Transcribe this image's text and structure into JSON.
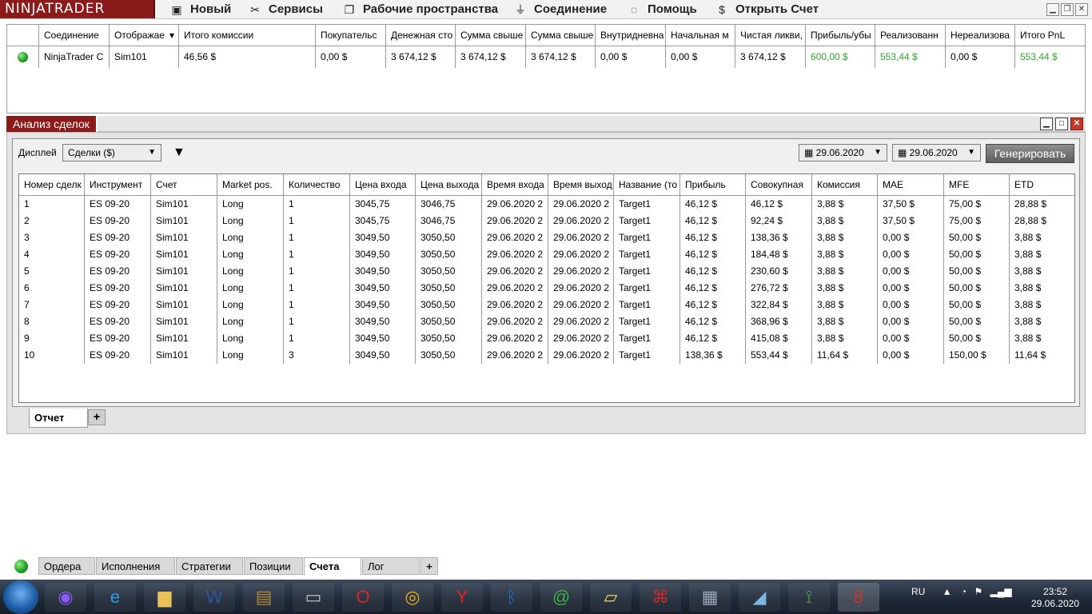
{
  "app": {
    "logo": "NINJATRADER"
  },
  "menu": [
    {
      "label": "Новый",
      "icon": "new-icon",
      "glyph": "▣"
    },
    {
      "label": "Сервисы",
      "icon": "tools-icon",
      "glyph": "✂"
    },
    {
      "label": "Рабочие пространства",
      "icon": "workspaces-icon",
      "glyph": "❐"
    },
    {
      "label": "Соединение",
      "icon": "plug-icon",
      "glyph": "⏚"
    },
    {
      "label": "Помощь",
      "icon": "help-icon",
      "glyph": "◌"
    },
    {
      "label": "Открыть Счет",
      "icon": "dollar-icon",
      "glyph": "$"
    }
  ],
  "accounts": {
    "headers": [
      "",
      "Соединение",
      "Отображае",
      "Итого комиссии",
      "Покупательс",
      "Денежная сто",
      "Сумма свыше",
      "Сумма свыше",
      "Внутридневна",
      "Начальная м",
      "Чистая ликви,",
      "Прибыль/убы",
      "Реализованн",
      "Нереализова",
      "Итого PnL"
    ],
    "sort_glyph": "▾",
    "row": [
      "",
      "NinjaTrader C",
      "Sim101",
      "46,56 $",
      "0,00 $",
      "3 674,12 $",
      "3 674,12 $",
      "3 674,12 $",
      "0,00 $",
      "0,00 $",
      "3 674,12 $",
      "600,00 $",
      "553,44 $",
      "0,00 $",
      "553,44 $"
    ]
  },
  "trade_analysis": {
    "title": "Анализ сделок",
    "display_label": "Дисплей",
    "display_value": "Сделки ($)",
    "date_from": "29.06.2020",
    "date_to": "29.06.2020",
    "generate_label": "Генерировать",
    "headers": [
      "Номер сделк",
      "Инструмент",
      "Счет",
      "Market pos.",
      "Количество",
      "Цена входа",
      "Цена выхода",
      "Время входа",
      "Время выход",
      "Название (то",
      "Прибыль",
      "Совокупная",
      "Комиссия",
      "MAE",
      "MFE",
      "ETD"
    ],
    "rows": [
      [
        "1",
        "ES 09-20",
        "Sim101",
        "Long",
        "1",
        "3045,75",
        "3046,75",
        "29.06.2020 2",
        "29.06.2020 2",
        "Target1",
        "46,12 $",
        "46,12 $",
        "3,88 $",
        "37,50 $",
        "75,00 $",
        "28,88 $"
      ],
      [
        "2",
        "ES 09-20",
        "Sim101",
        "Long",
        "1",
        "3045,75",
        "3046,75",
        "29.06.2020 2",
        "29.06.2020 2",
        "Target1",
        "46,12 $",
        "92,24 $",
        "3,88 $",
        "37,50 $",
        "75,00 $",
        "28,88 $"
      ],
      [
        "3",
        "ES 09-20",
        "Sim101",
        "Long",
        "1",
        "3049,50",
        "3050,50",
        "29.06.2020 2",
        "29.06.2020 2",
        "Target1",
        "46,12 $",
        "138,36 $",
        "3,88 $",
        "0,00 $",
        "50,00 $",
        "3,88 $"
      ],
      [
        "4",
        "ES 09-20",
        "Sim101",
        "Long",
        "1",
        "3049,50",
        "3050,50",
        "29.06.2020 2",
        "29.06.2020 2",
        "Target1",
        "46,12 $",
        "184,48 $",
        "3,88 $",
        "0,00 $",
        "50,00 $",
        "3,88 $"
      ],
      [
        "5",
        "ES 09-20",
        "Sim101",
        "Long",
        "1",
        "3049,50",
        "3050,50",
        "29.06.2020 2",
        "29.06.2020 2",
        "Target1",
        "46,12 $",
        "230,60 $",
        "3,88 $",
        "0,00 $",
        "50,00 $",
        "3,88 $"
      ],
      [
        "6",
        "ES 09-20",
        "Sim101",
        "Long",
        "1",
        "3049,50",
        "3050,50",
        "29.06.2020 2",
        "29.06.2020 2",
        "Target1",
        "46,12 $",
        "276,72 $",
        "3,88 $",
        "0,00 $",
        "50,00 $",
        "3,88 $"
      ],
      [
        "7",
        "ES 09-20",
        "Sim101",
        "Long",
        "1",
        "3049,50",
        "3050,50",
        "29.06.2020 2",
        "29.06.2020 2",
        "Target1",
        "46,12 $",
        "322,84 $",
        "3,88 $",
        "0,00 $",
        "50,00 $",
        "3,88 $"
      ],
      [
        "8",
        "ES 09-20",
        "Sim101",
        "Long",
        "1",
        "3049,50",
        "3050,50",
        "29.06.2020 2",
        "29.06.2020 2",
        "Target1",
        "46,12 $",
        "368,96 $",
        "3,88 $",
        "0,00 $",
        "50,00 $",
        "3,88 $"
      ],
      [
        "9",
        "ES 09-20",
        "Sim101",
        "Long",
        "1",
        "3049,50",
        "3050,50",
        "29.06.2020 2",
        "29.06.2020 2",
        "Target1",
        "46,12 $",
        "415,08 $",
        "3,88 $",
        "0,00 $",
        "50,00 $",
        "3,88 $"
      ],
      [
        "10",
        "ES 09-20",
        "Sim101",
        "Long",
        "3",
        "3049,50",
        "3050,50",
        "29.06.2020 2",
        "29.06.2020 2",
        "Target1",
        "138,36 $",
        "553,44 $",
        "11,64 $",
        "0,00 $",
        "150,00 $",
        "11,64 $"
      ]
    ],
    "report_tab": "Отчет",
    "add_tab": "+"
  },
  "bottom_tabs": [
    "Ордера",
    "Исполнения",
    "Стратегии",
    "Позиции",
    "Счета",
    "Лог"
  ],
  "bottom_active": "Счета",
  "bottom_add": "+",
  "colors": {
    "brand": "#8b1a1a",
    "profit": "#2fa82f"
  },
  "taskbar": {
    "apps": [
      {
        "icon": "alice-icon",
        "glyph": "◉",
        "color": "#8a5cf5"
      },
      {
        "icon": "ie-icon",
        "glyph": "e",
        "color": "#2d9be3"
      },
      {
        "icon": "explorer-icon",
        "glyph": "▆",
        "color": "#e8c15a"
      },
      {
        "icon": "word-icon",
        "glyph": "W",
        "color": "#2b5797"
      },
      {
        "icon": "archive-icon",
        "glyph": "▤",
        "color": "#b08a3e"
      },
      {
        "icon": "scanner-icon",
        "glyph": "▭",
        "color": "#bfbfbf"
      },
      {
        "icon": "opera-icon",
        "glyph": "O",
        "color": "#d8262c"
      },
      {
        "icon": "chrome-icon",
        "glyph": "◎",
        "color": "#e8b31c"
      },
      {
        "icon": "yandex-icon",
        "glyph": "Y",
        "color": "#e52620"
      },
      {
        "icon": "bluetooth-icon",
        "glyph": "ᛒ",
        "color": "#1e6fd1"
      },
      {
        "icon": "mail-icon",
        "glyph": "@",
        "color": "#3cb043"
      },
      {
        "icon": "notes-icon",
        "glyph": "▱",
        "color": "#e6d86a"
      },
      {
        "icon": "pdf-icon",
        "glyph": "⌘",
        "color": "#d4262a"
      },
      {
        "icon": "calculator-icon",
        "glyph": "▦",
        "color": "#9aa6b3"
      },
      {
        "icon": "ruler-icon",
        "glyph": "◢",
        "color": "#7ab6e0"
      },
      {
        "icon": "metatrader-icon",
        "glyph": "⟟",
        "color": "#4aa64a"
      },
      {
        "icon": "ninjatrader-icon",
        "glyph": "8",
        "color": "#c0392b"
      }
    ],
    "lang": "RU",
    "time": "23:52",
    "date": "29.06.2020"
  }
}
